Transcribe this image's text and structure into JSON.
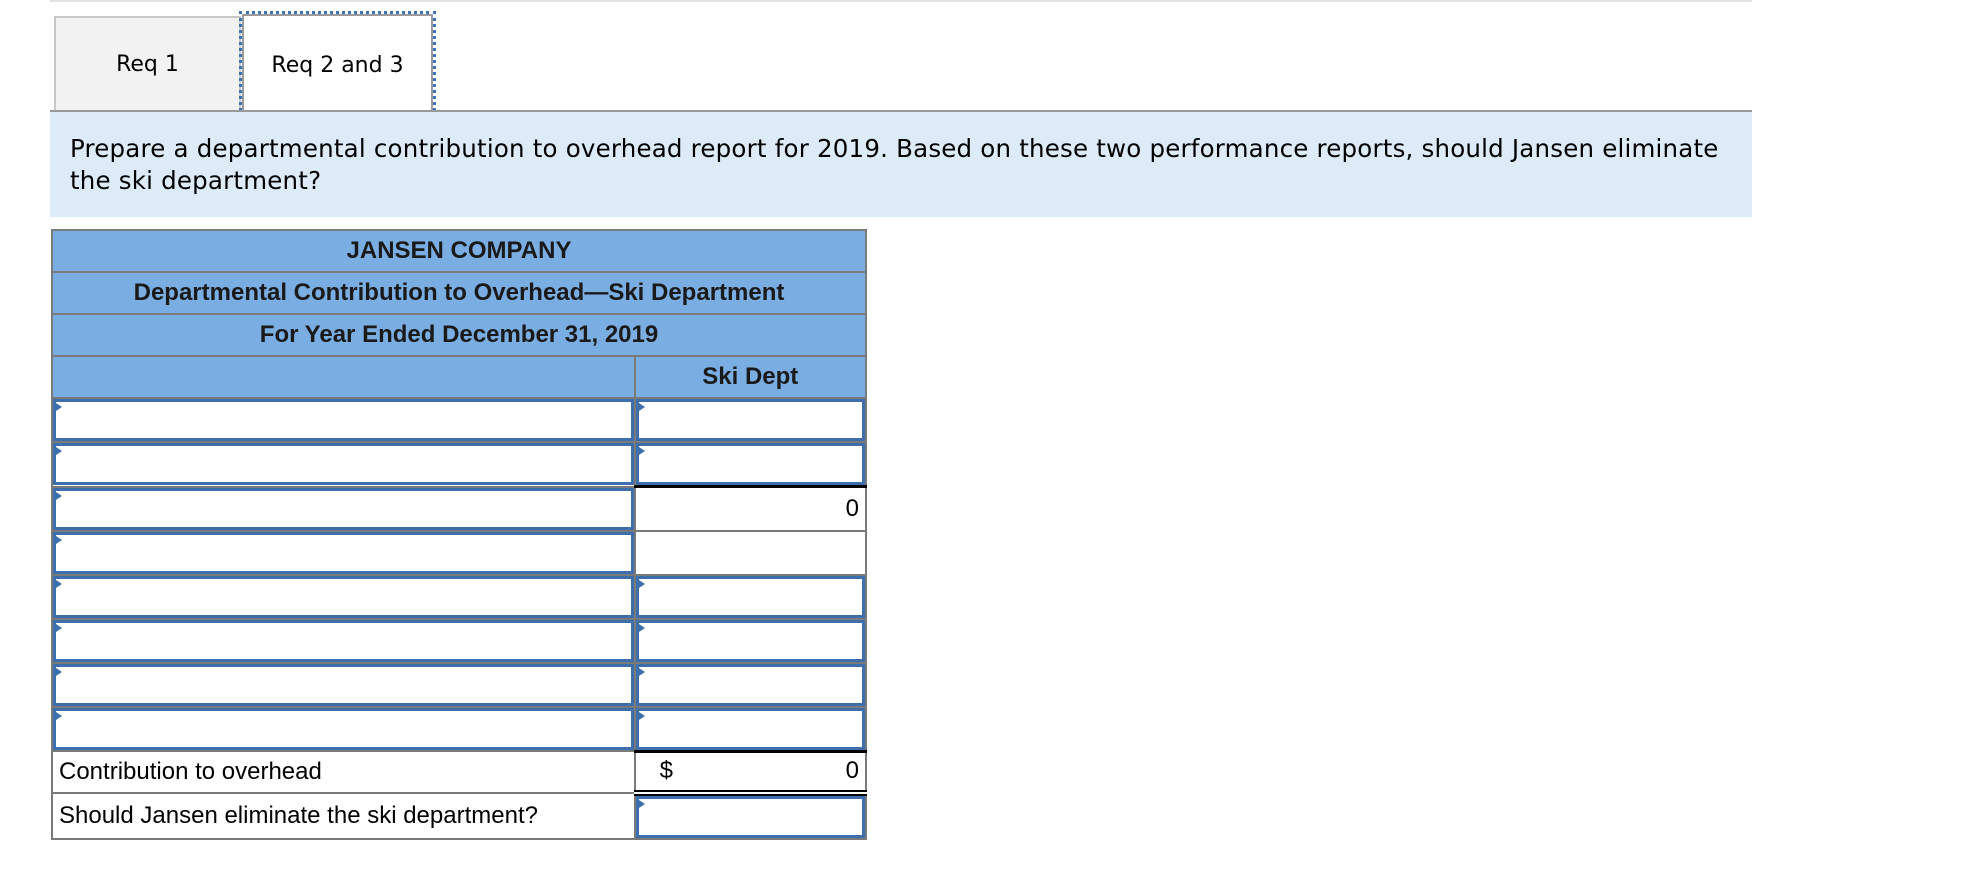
{
  "tabs": [
    {
      "label": "Req 1",
      "active": false
    },
    {
      "label": "Req 2 and 3",
      "active": true
    }
  ],
  "instructions": "Prepare a departmental contribution to overhead report for 2019. Based on these two performance reports, should Jansen eliminate the ski department?",
  "report": {
    "company": "JANSEN COMPANY",
    "title": "Departmental Contribution to Overhead—Ski Department",
    "period": "For Year Ended December 31, 2019",
    "column_header": "Ski Dept",
    "rows": [
      {
        "label": "",
        "value": "",
        "value_editable": true
      },
      {
        "label": "",
        "value": "",
        "value_editable": true
      },
      {
        "label": "",
        "value": "0",
        "value_editable": false
      },
      {
        "label": "",
        "value": "",
        "value_editable": false
      },
      {
        "label": "",
        "value": "",
        "value_editable": true
      },
      {
        "label": "",
        "value": "",
        "value_editable": true
      },
      {
        "label": "",
        "value": "",
        "value_editable": true
      },
      {
        "label": "",
        "value": "",
        "value_editable": true
      }
    ],
    "total_label": "Contribution to overhead",
    "total_currency": "$",
    "total_value": "0",
    "question_label": "Should Jansen eliminate the ski department?",
    "question_answer": ""
  }
}
